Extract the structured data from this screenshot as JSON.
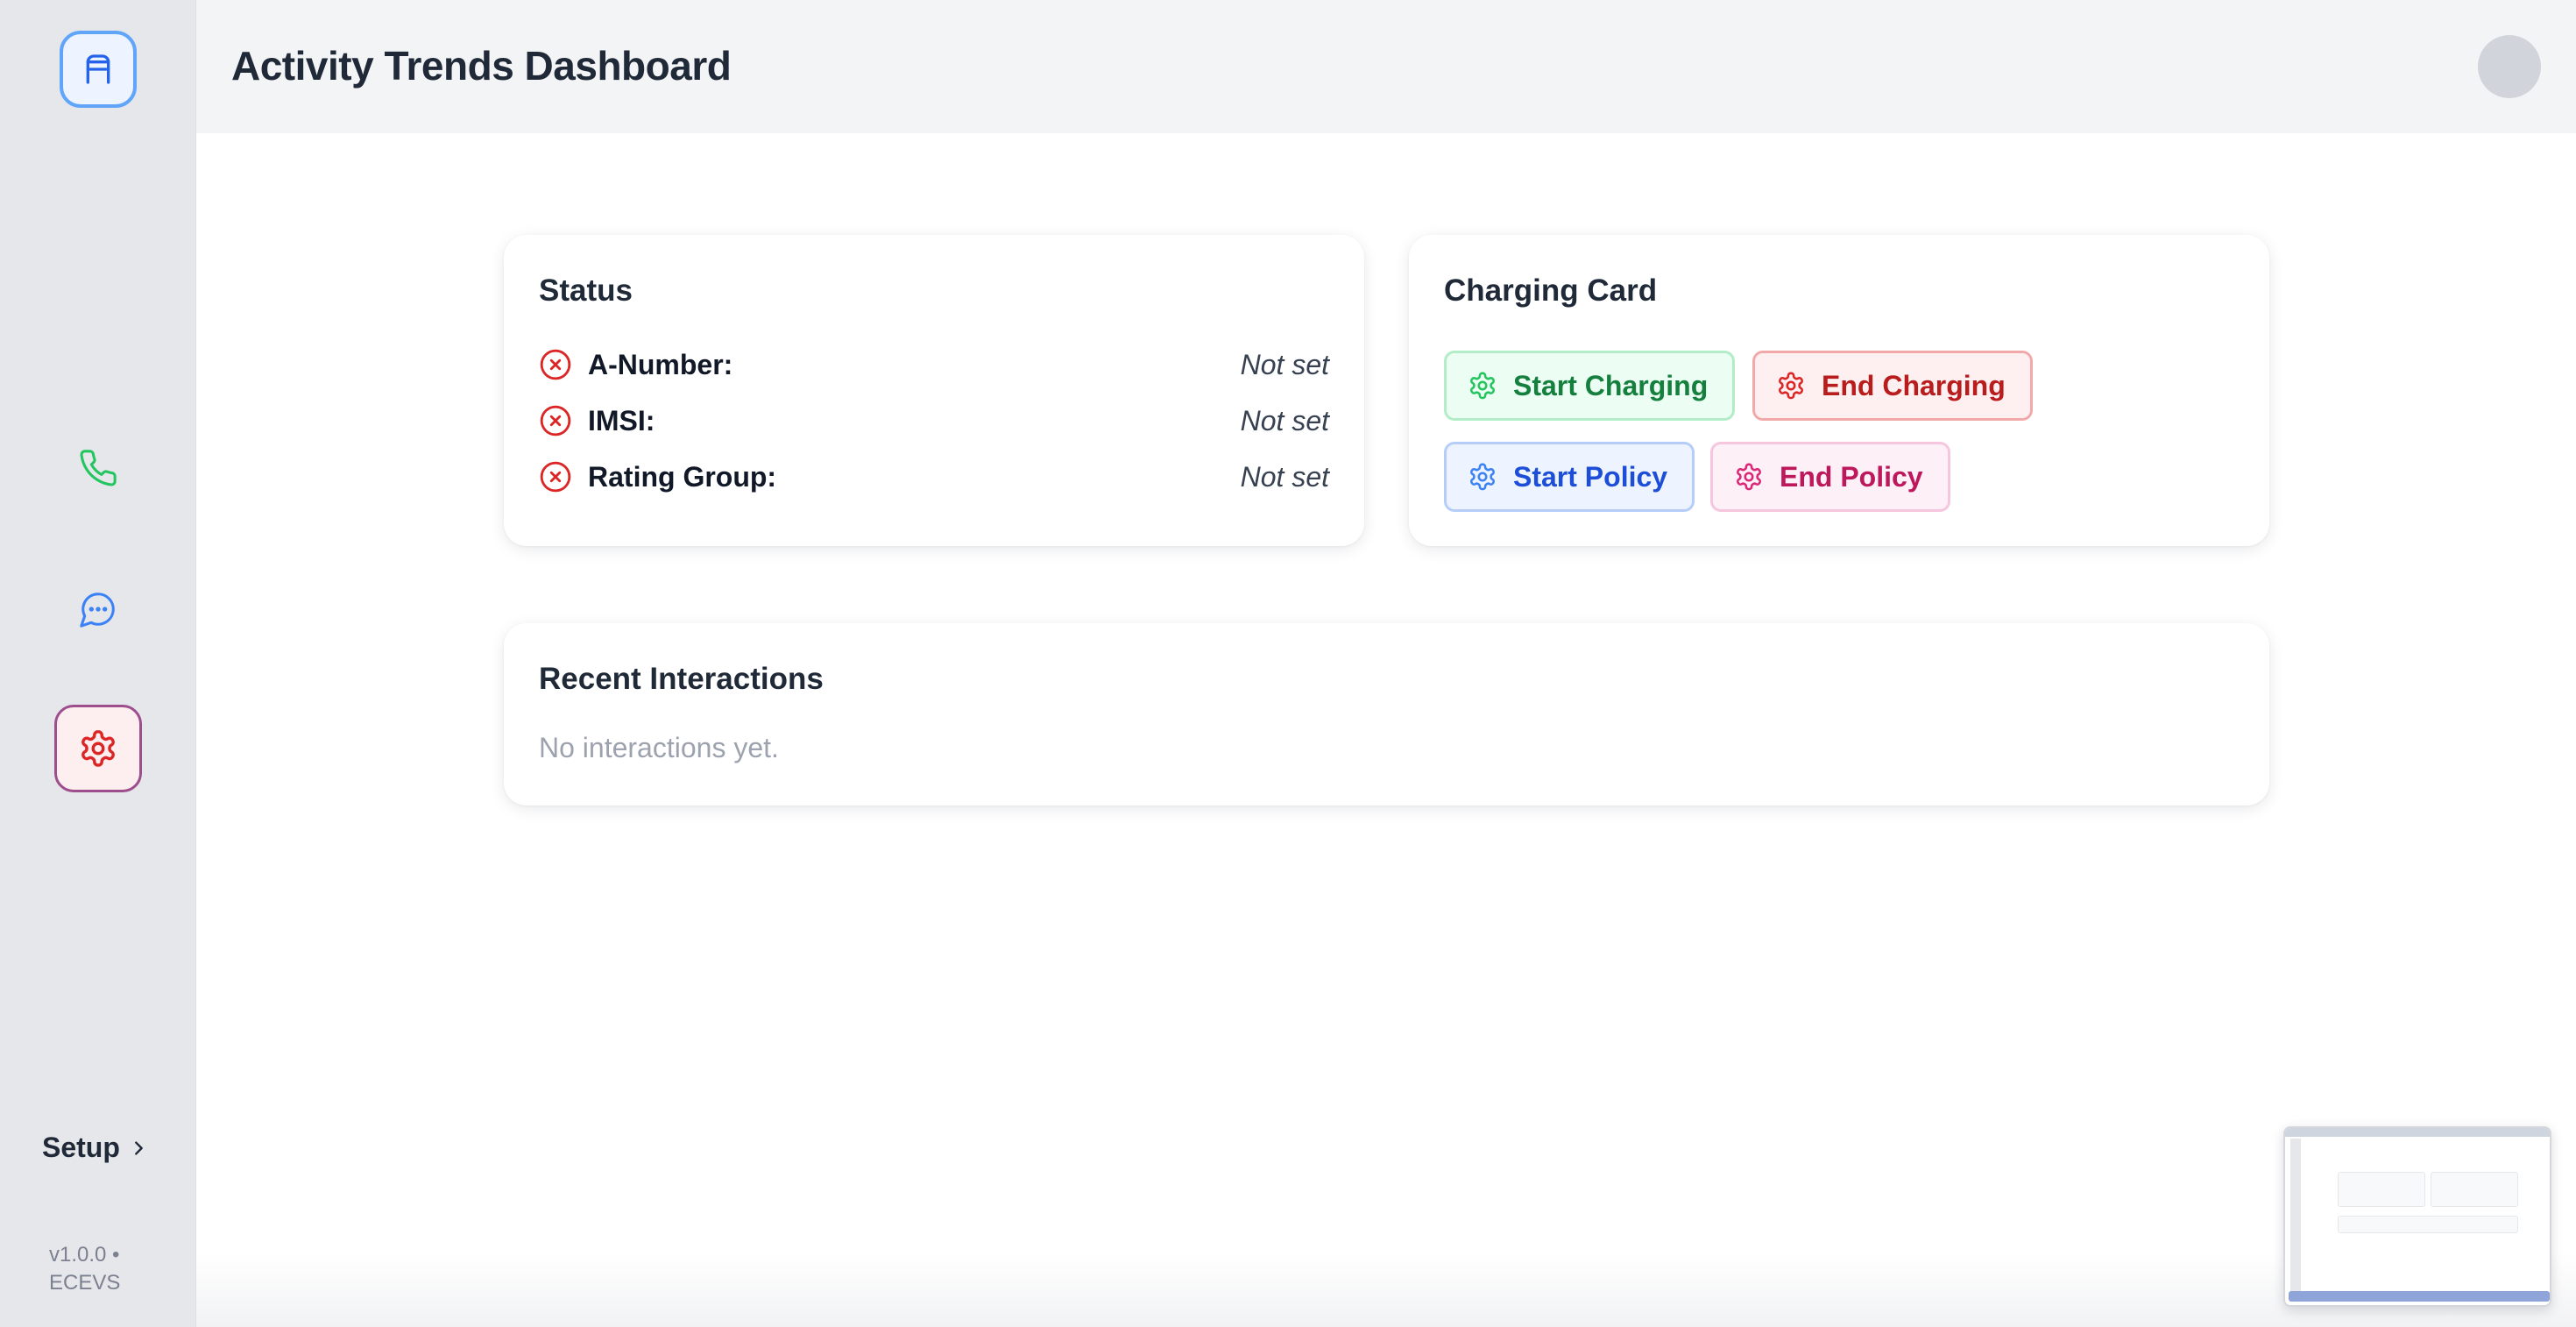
{
  "header": {
    "title": "Activity Trends Dashboard"
  },
  "sidebar": {
    "logo_icon": "app-logo-icon",
    "items": [
      {
        "icon": "phone-icon",
        "color": "#22c55e"
      },
      {
        "icon": "chat-icon",
        "color": "#3b82f6"
      },
      {
        "icon": "gear-icon",
        "color": "#dc2626",
        "active": true
      }
    ],
    "setup_label": "Setup",
    "version_line1": "v1.0.0 •",
    "version_line2": "ECEVS"
  },
  "status_card": {
    "title": "Status",
    "rows": [
      {
        "label": "A-Number:",
        "value": "Not set"
      },
      {
        "label": "IMSI:",
        "value": "Not set"
      },
      {
        "label": "Rating Group:",
        "value": "Not set"
      }
    ]
  },
  "charging_card": {
    "title": "Charging Card",
    "buttons": [
      {
        "label": "Start Charging",
        "color": "#15803d"
      },
      {
        "label": "End Charging",
        "color": "#b91c1c"
      },
      {
        "label": "Start Policy",
        "color": "#1d4ed8"
      },
      {
        "label": "End Policy",
        "color": "#be185d"
      }
    ]
  },
  "recent_card": {
    "title": "Recent Interactions",
    "empty_text": "No interactions yet."
  }
}
